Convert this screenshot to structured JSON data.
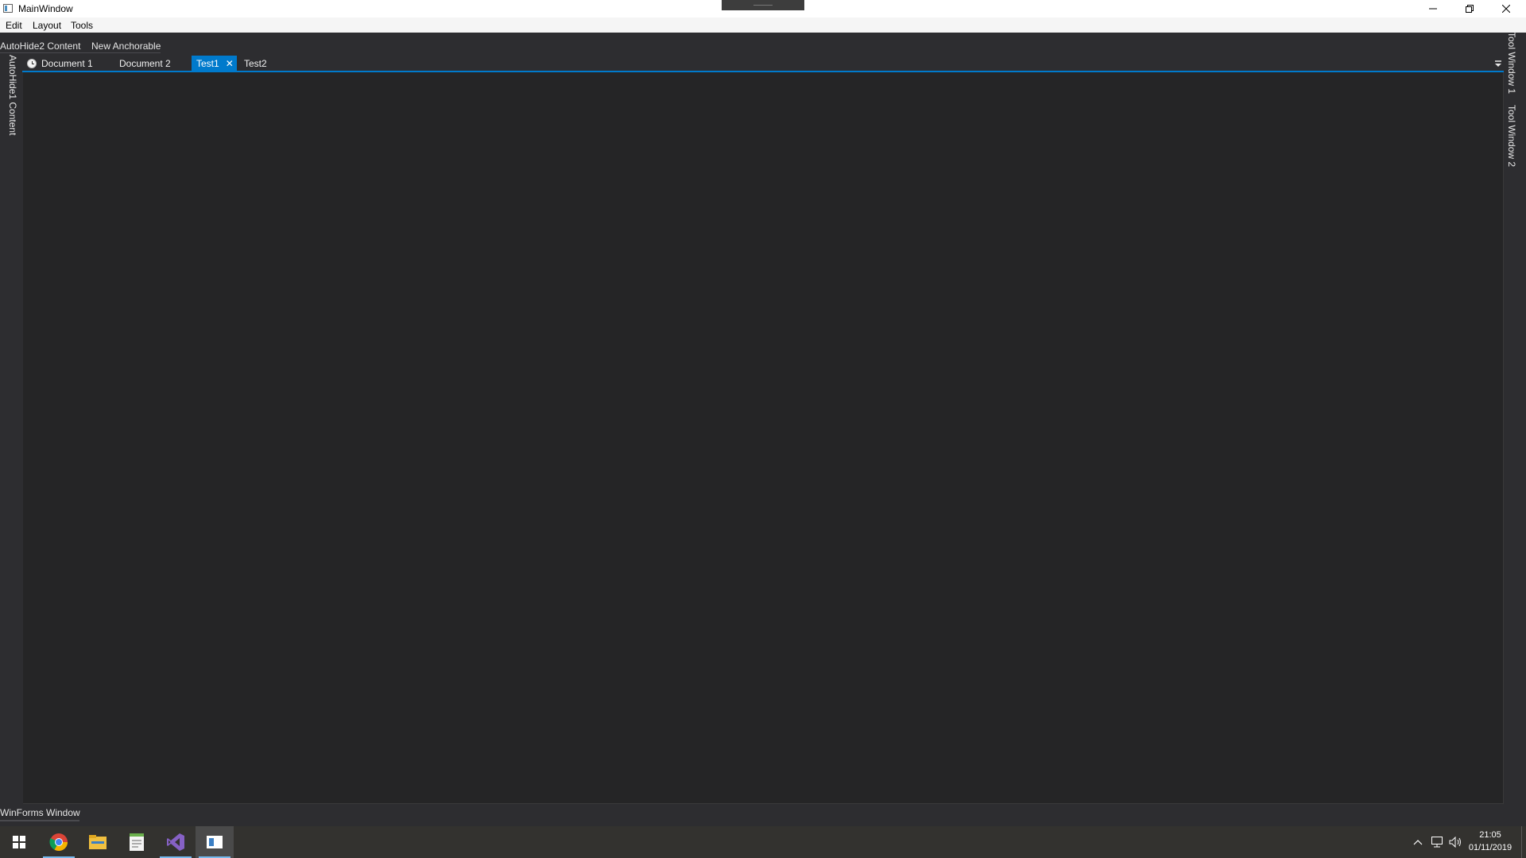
{
  "window": {
    "title": "MainWindow",
    "icon": "app-window-icon"
  },
  "caption_buttons": [
    "minimize-icon",
    "restore-icon",
    "close-icon"
  ],
  "menu": {
    "items": [
      "Edit",
      "Layout",
      "Tools"
    ]
  },
  "toolbar": {
    "autohide2_label": "AutoHide2 Content",
    "new_anchorable_label": "New Anchorable"
  },
  "left_side_tabs": [
    "AutoHide1 Content"
  ],
  "right_side_tabs": [
    "Tool Window 1",
    "Tool Window 2"
  ],
  "document_tabs": [
    {
      "label": "Document 1",
      "icon": "clock-icon",
      "active": false
    },
    {
      "label": "Document 2",
      "active": false
    },
    {
      "label": "Test1",
      "active": true,
      "close": "✕"
    },
    {
      "label": "Test2",
      "active": false
    }
  ],
  "bottom_panel": {
    "label": "WinForms Window"
  },
  "taskbar": {
    "apps": [
      "windows-start-icon",
      "chrome-icon",
      "file-explorer-icon",
      "notepad-icon",
      "visual-studio-icon",
      "mainwindow-app-icon"
    ],
    "tray": [
      "chevron-up-icon",
      "network-icon",
      "volume-icon"
    ],
    "time": "21:05",
    "date": "01/11/2019"
  },
  "colors": {
    "accent": "#007acc",
    "background": "#2d2d30",
    "document_area": "#252526",
    "taskbar": "#33322f"
  }
}
